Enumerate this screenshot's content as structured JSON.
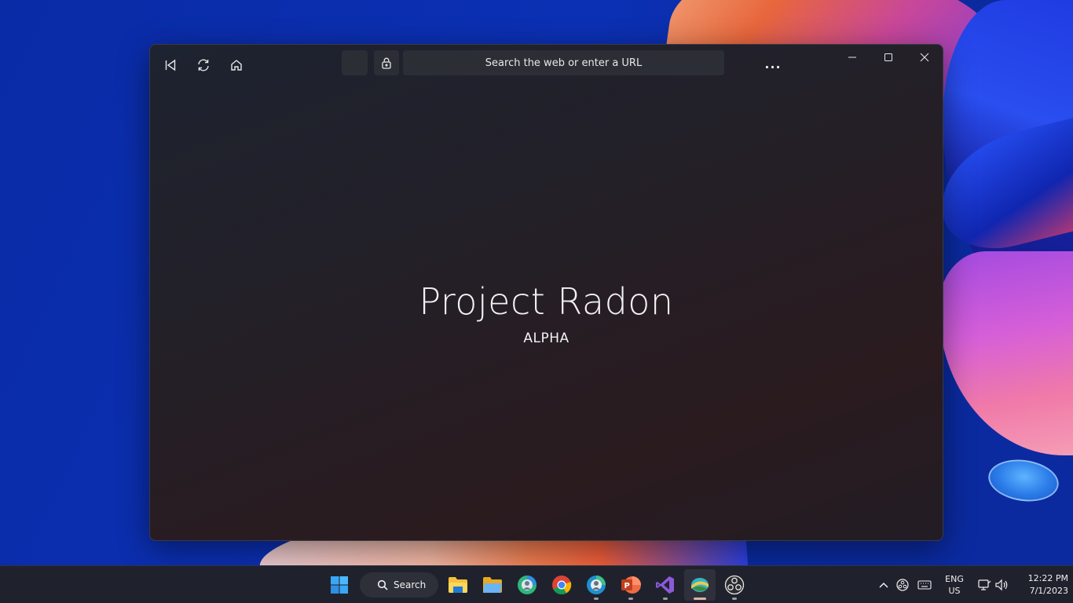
{
  "browser": {
    "url_placeholder": "Search the web or enter a URL",
    "more_label": "...",
    "hero_title": "Project Radon",
    "hero_subtitle": "ALPHA",
    "accent_color": "#2c2e36"
  },
  "taskbar": {
    "search_label": "Search",
    "apps": [
      {
        "name": "start",
        "icon": "windows-logo-icon"
      },
      {
        "name": "file-explorer",
        "icon": "folder-icon"
      },
      {
        "name": "folder",
        "icon": "folder-open-icon"
      },
      {
        "name": "edge-profile",
        "icon": "edge-icon"
      },
      {
        "name": "chrome",
        "icon": "chrome-icon"
      },
      {
        "name": "edge-dev",
        "icon": "edge-dev-icon"
      },
      {
        "name": "powerpoint",
        "icon": "powerpoint-icon"
      },
      {
        "name": "visual-studio",
        "icon": "visual-studio-icon"
      },
      {
        "name": "project-radon",
        "icon": "radon-icon"
      },
      {
        "name": "obs",
        "icon": "obs-icon"
      }
    ],
    "language": "ENG",
    "region": "US",
    "time": "12:22 PM",
    "date": "7/1/2023"
  }
}
